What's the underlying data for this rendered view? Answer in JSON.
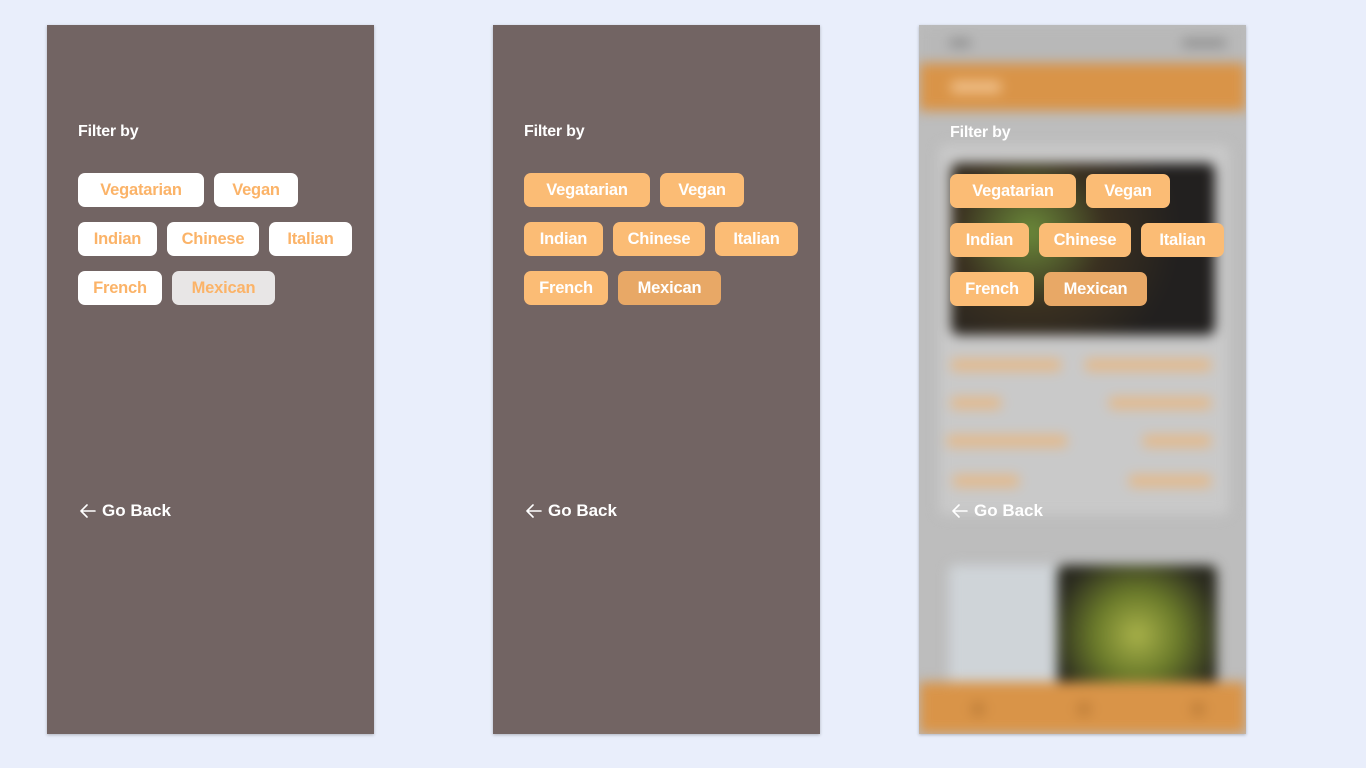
{
  "colors": {
    "page_bg": "#e9eefb",
    "panel_bg": "#726463",
    "chip_orange": "#fbbc75",
    "chip_white": "#ffffff",
    "accent_text": "#fbb368",
    "header_orange": "#d99448"
  },
  "panels": [
    {
      "title": "Filter by",
      "chips": [
        "Vegatarian",
        "Vegan",
        "Indian",
        "Chinese",
        "Italian",
        "French",
        "Mexican"
      ],
      "pressed": "Mexican",
      "back_label": "Go Back"
    },
    {
      "title": "Filter by",
      "chips": [
        "Vegatarian",
        "Vegan",
        "Indian",
        "Chinese",
        "Italian",
        "French",
        "Mexican"
      ],
      "pressed": "Mexican",
      "back_label": "Go Back"
    },
    {
      "title": "Filter by",
      "chips": [
        "Vegatarian",
        "Vegan",
        "Indian",
        "Chinese",
        "Italian",
        "French",
        "Mexican"
      ],
      "pressed": "Mexican",
      "back_label": "Go Back"
    }
  ],
  "icons": {
    "back": "arrow-left-icon"
  }
}
